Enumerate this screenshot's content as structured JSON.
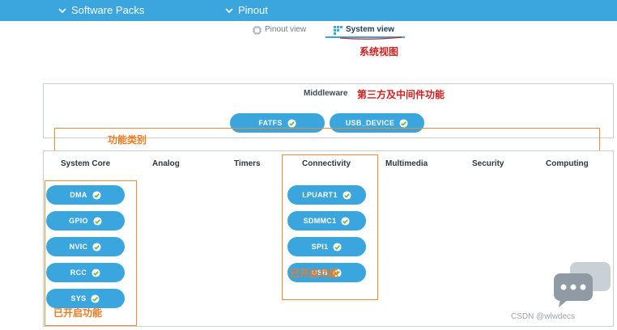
{
  "menu": {
    "software_packs": "Software Packs",
    "pinout": "Pinout"
  },
  "tabs": {
    "pinout_view": "Pinout view",
    "system_view": "System view"
  },
  "annotations": {
    "system_view_cn": "系统视图",
    "middleware_cn": "第三方及中间件功能",
    "category_cn": "功能类别",
    "enabled_left_cn": "已开启功能",
    "enabled_right_cn": "已开启功能"
  },
  "middleware": {
    "title": "Middleware",
    "items": [
      "FATFS",
      "USB_DEVICE"
    ]
  },
  "categories": [
    "System Core",
    "Analog",
    "Timers",
    "Connectivity",
    "Multimedia",
    "Security",
    "Computing"
  ],
  "system_core_items": [
    "DMA",
    "GPIO",
    "NVIC",
    "RCC",
    "SYS"
  ],
  "connectivity_items": [
    "LPUART1",
    "SDMMC1",
    "SPI1",
    "USB"
  ],
  "watermark": "CSDN @wlwdecs",
  "colors": {
    "topbar": "#3aa6dd",
    "pill": "#3aa6dd",
    "annotation_red": "#d21f1f",
    "annotation_orange": "#f07a1f"
  },
  "icons": {
    "menu_chevron": "chevron-down-icon",
    "pinout_view": "chip-icon",
    "system_view": "grid-icon",
    "enabled": "check-circle-icon"
  }
}
